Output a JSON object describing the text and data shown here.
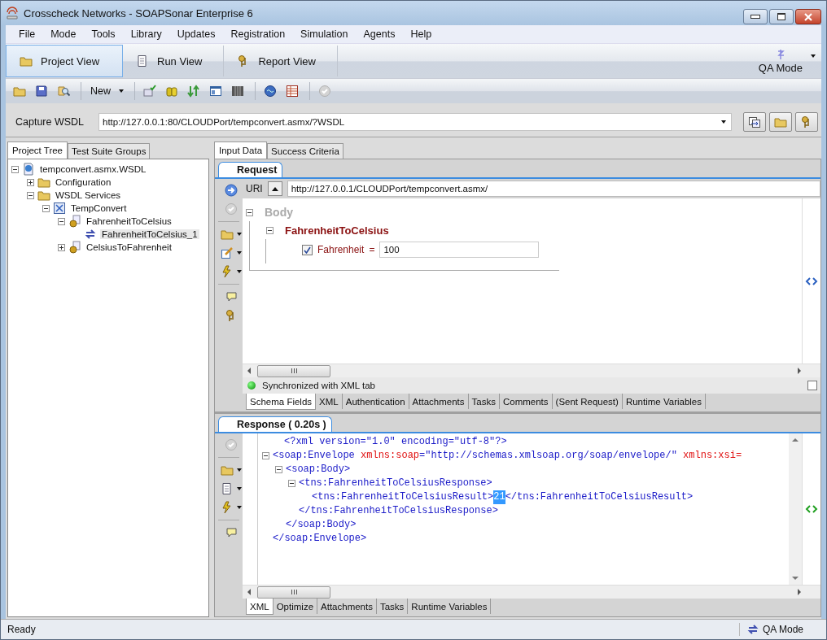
{
  "window": {
    "title": "Crosscheck Networks - SOAPSonar Enterprise 6"
  },
  "menu": [
    "File",
    "Mode",
    "Tools",
    "Library",
    "Updates",
    "Registration",
    "Simulation",
    "Agents",
    "Help"
  ],
  "views": [
    {
      "label": "Project View",
      "selected": true
    },
    {
      "label": "Run View",
      "selected": false
    },
    {
      "label": "Report View",
      "selected": false
    }
  ],
  "mode_button": {
    "label": "QA Mode"
  },
  "toolbar": {
    "new_label": "New"
  },
  "capture": {
    "label": "Capture WSDL",
    "value": "http://127.0.0.1:80/CLOUDPort/tempconvert.asmx/?WSDL"
  },
  "left_tabs": [
    {
      "label": "Project Tree",
      "selected": true
    },
    {
      "label": "Test Suite Groups",
      "selected": false
    }
  ],
  "tree": [
    {
      "label": "tempconvert.asmx.WSDL",
      "kind": "wsdl",
      "expanded": true,
      "selected": false,
      "children": [
        {
          "label": "Configuration",
          "kind": "folder",
          "expanded": false,
          "selected": false
        },
        {
          "label": "WSDL Services",
          "kind": "folder",
          "expanded": true,
          "selected": false,
          "children": [
            {
              "label": "TempConvert",
              "kind": "service",
              "expanded": true,
              "selected": false,
              "children": [
                {
                  "label": "FahrenheitToCelsius",
                  "kind": "operation",
                  "expanded": true,
                  "selected": false,
                  "children": [
                    {
                      "label": "FahrenheitToCelsius_1",
                      "kind": "testcase",
                      "selected": true
                    }
                  ]
                },
                {
                  "label": "CelsiusToFahrenheit",
                  "kind": "operation",
                  "expanded": false,
                  "selected": false
                }
              ]
            }
          ]
        }
      ]
    }
  ],
  "right_tabs": [
    {
      "label": "Input Data",
      "selected": true
    },
    {
      "label": "Success Criteria",
      "selected": false
    }
  ],
  "request": {
    "title": "Request",
    "uri_label": "URI",
    "uri": "http://127.0.0.1/CLOUDPort/tempconvert.asmx/",
    "body_label": "Body",
    "operation": "FahrenheitToCelsius",
    "fields": [
      {
        "name": "Fahrenheit",
        "separator": "=",
        "checked": true,
        "value": "100"
      }
    ],
    "sync_status": "Synchronized with XML tab",
    "sync_checked": false,
    "tabs": [
      {
        "label": "Schema Fields",
        "selected": true
      },
      {
        "label": "XML",
        "selected": false
      },
      {
        "label": "Authentication",
        "selected": false
      },
      {
        "label": "Attachments",
        "selected": false
      },
      {
        "label": "Tasks",
        "selected": false
      },
      {
        "label": "Comments",
        "selected": false
      },
      {
        "label": "(Sent Request)",
        "selected": false
      },
      {
        "label": "Runtime Variables",
        "selected": false
      }
    ]
  },
  "response": {
    "title": "Response ( 0.20s )",
    "xml": [
      {
        "open": [
          {
            "kind": "markup",
            "text": "<?xml version=\"1.0\" encoding=\"utf-8\"?>"
          }
        ]
      },
      {
        "open": [
          {
            "kind": "markup",
            "text": "<soap:Envelope "
          },
          {
            "kind": "attr",
            "text": "xmlns:soap"
          },
          {
            "kind": "markup",
            "text": "=\"http://schemas.xmlsoap.org/soap/envelope/\" "
          },
          {
            "kind": "attr",
            "text": "xmlns:xsi="
          }
        ],
        "close": [
          {
            "kind": "markup",
            "text": "</soap:Envelope>"
          }
        ],
        "children": [
          {
            "open": [
              {
                "kind": "markup",
                "text": "<soap:Body>"
              }
            ],
            "close": [
              {
                "kind": "markup",
                "text": "</soap:Body>"
              }
            ],
            "children": [
              {
                "open": [
                  {
                    "kind": "markup",
                    "text": "<tns:FahrenheitToCelsiusResponse>"
                  }
                ],
                "close": [
                  {
                    "kind": "markup",
                    "text": "</tns:FahrenheitToCelsiusResponse>"
                  }
                ],
                "children": [
                  {
                    "open": [
                      {
                        "kind": "markup",
                        "text": "<tns:FahrenheitToCelsiusResult>"
                      },
                      {
                        "kind": "text",
                        "text": "21",
                        "selected": true
                      },
                      {
                        "kind": "markup",
                        "text": "</tns:FahrenheitToCelsiusResult>"
                      }
                    ]
                  }
                ]
              }
            ]
          }
        ]
      }
    ],
    "tabs": [
      {
        "label": "XML",
        "selected": true
      },
      {
        "label": "Optimize",
        "selected": false
      },
      {
        "label": "Attachments",
        "selected": false
      },
      {
        "label": "Tasks",
        "selected": false
      },
      {
        "label": "Runtime Variables",
        "selected": false
      }
    ]
  },
  "status_bar": {
    "text": "Ready",
    "mode": "QA Mode"
  }
}
